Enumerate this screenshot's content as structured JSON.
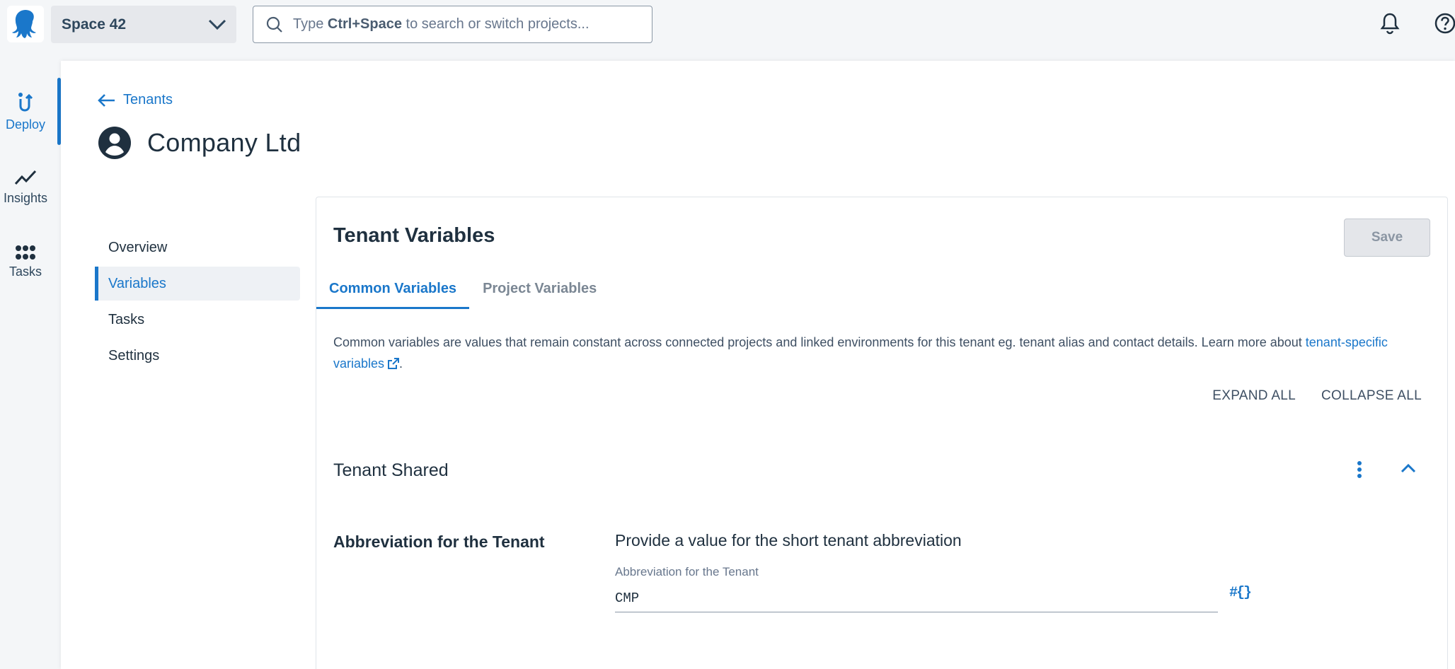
{
  "topbar": {
    "space_name": "Space 42",
    "search_placeholder_prefix": "Type ",
    "search_placeholder_shortcut": "Ctrl+Space",
    "search_placeholder_suffix": " to search or switch projects..."
  },
  "rail": {
    "items": [
      {
        "label": "Deploy",
        "icon": "deploy-icon",
        "active": true
      },
      {
        "label": "Insights",
        "icon": "insights-icon",
        "active": false
      },
      {
        "label": "Tasks",
        "icon": "tasks-icon",
        "active": false
      }
    ]
  },
  "breadcrumb": {
    "back_label": "Tenants"
  },
  "page": {
    "title": "Company Ltd"
  },
  "subnav": {
    "items": [
      {
        "label": "Overview",
        "active": false
      },
      {
        "label": "Variables",
        "active": true
      },
      {
        "label": "Tasks",
        "active": false
      },
      {
        "label": "Settings",
        "active": false
      }
    ]
  },
  "card": {
    "title": "Tenant Variables",
    "save_label": "Save",
    "tabs": [
      {
        "label": "Common Variables",
        "active": true
      },
      {
        "label": "Project Variables",
        "active": false
      }
    ],
    "description": "Common variables are values that remain constant across connected projects and linked environments for this tenant eg. tenant alias and contact details. Learn more about ",
    "description_link": "tenant-specific variables",
    "description_end": ".",
    "expand_all": "EXPAND ALL",
    "collapse_all": "COLLAPSE ALL",
    "section_title": "Tenant Shared",
    "variable": {
      "name": "Abbreviation for the Tenant",
      "help_text": "Provide a value for the short tenant abbreviation",
      "field_label": "Abbreviation for the Tenant",
      "value": "CMP",
      "insert_label": "#{}"
    }
  },
  "colors": {
    "accent": "#1a77ca",
    "text": "#1f303f",
    "background": "#f4f6f8"
  }
}
